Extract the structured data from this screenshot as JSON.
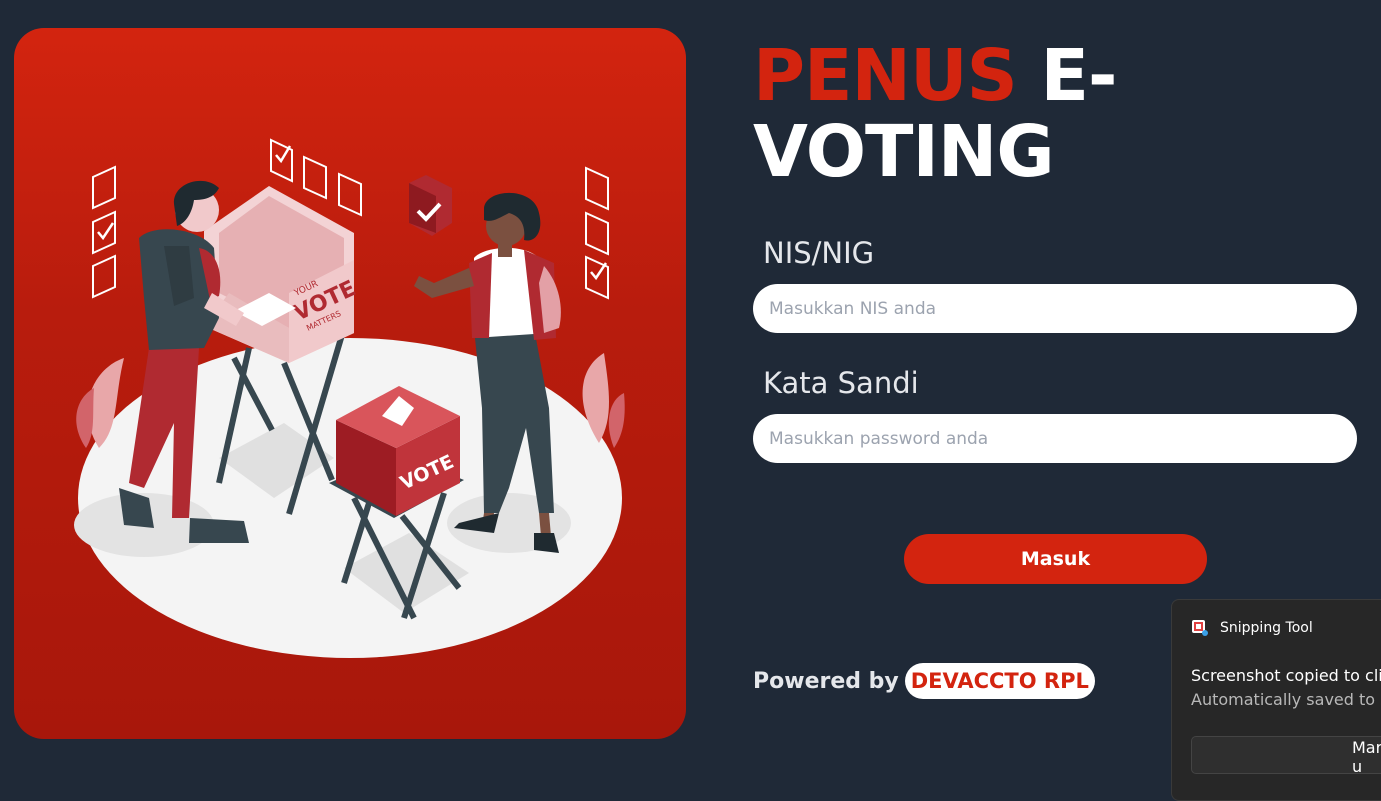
{
  "title": {
    "accent": "PENUS",
    "rest": " E-VOTING"
  },
  "form": {
    "nis_label": "NIS/NIG",
    "nis_placeholder": "Masukkan NIS anda",
    "password_label": "Kata Sandi",
    "password_placeholder": "Masukkan password anda",
    "submit_label": "Masuk"
  },
  "footer": {
    "powered_by": "Powered by",
    "brand": "DEVACCTO RPL"
  },
  "illustration": {
    "booth_text_small": "YOUR",
    "booth_text": "VOTE",
    "booth_text_sub": "MATTERS",
    "box_text": "VOTE"
  },
  "toast": {
    "app_name": "Snipping Tool",
    "message": "Screenshot copied to clip",
    "sub_message": "Automatically saved to sc",
    "action_label": "Mark-u"
  },
  "colors": {
    "accent": "#d3240f",
    "background": "#1f2937"
  },
  "icons": {
    "toast_app": "snipping-tool-icon"
  }
}
